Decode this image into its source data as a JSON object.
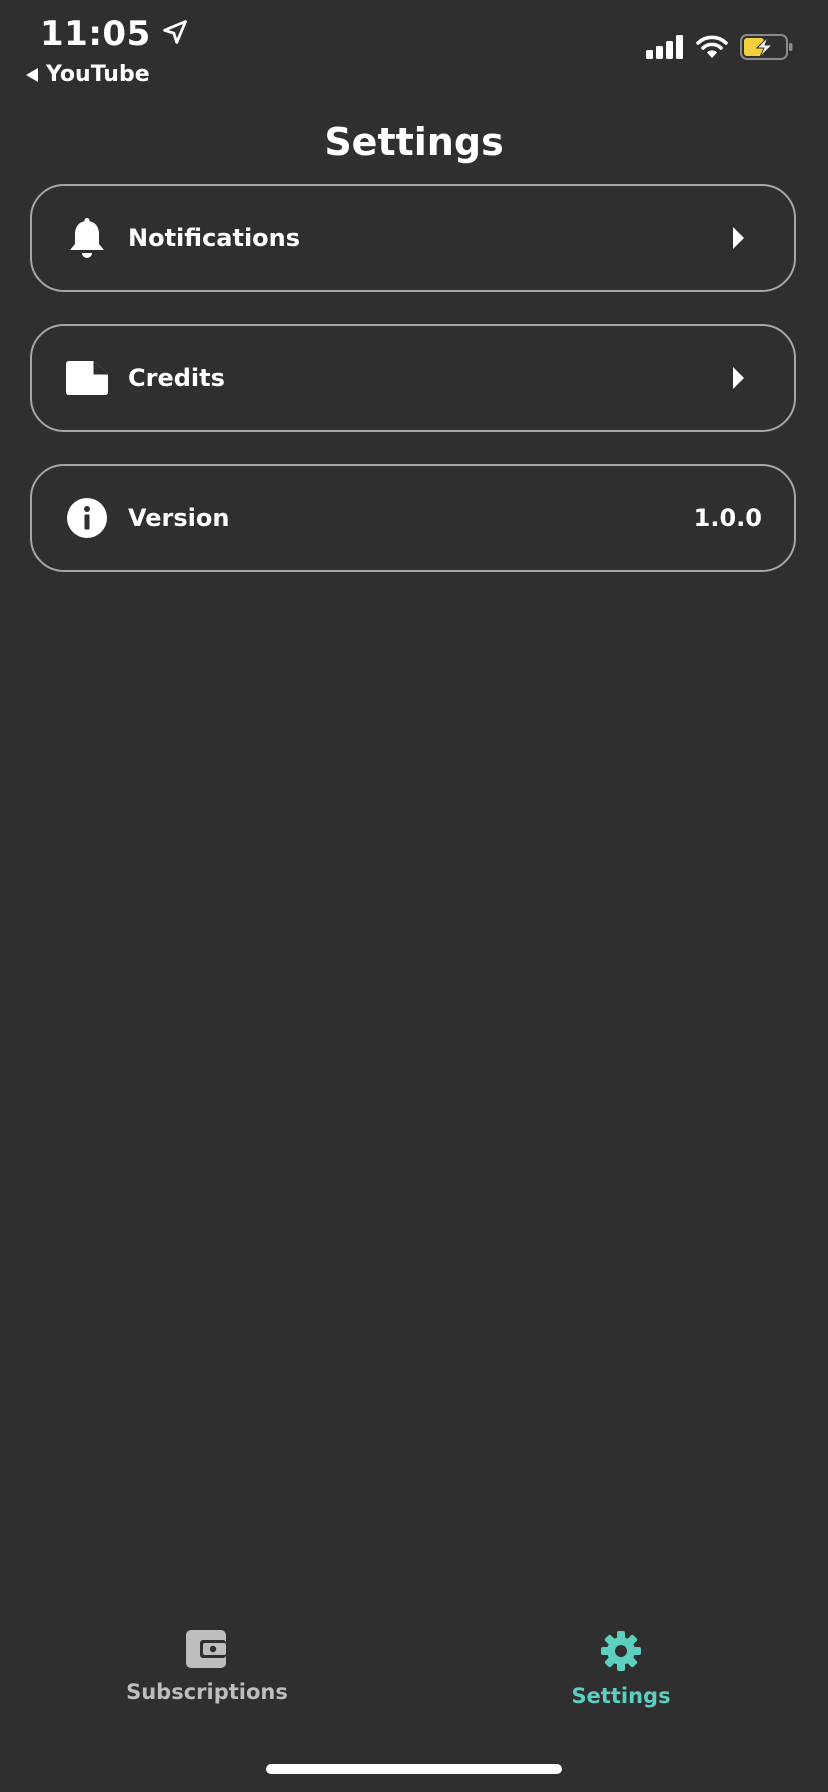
{
  "status_bar": {
    "time": "11:05",
    "back_app": "YouTube"
  },
  "header": {
    "title": "Settings"
  },
  "settings": {
    "items": [
      {
        "label": "Notifications",
        "icon": "bell-icon",
        "has_chevron": true
      },
      {
        "label": "Credits",
        "icon": "document-icon",
        "has_chevron": true
      },
      {
        "label": "Version",
        "icon": "info-icon",
        "value": "1.0.0"
      }
    ]
  },
  "tab_bar": {
    "tabs": [
      {
        "label": "Subscriptions",
        "icon": "wallet-icon",
        "active": false
      },
      {
        "label": "Settings",
        "icon": "gear-icon",
        "active": true
      }
    ]
  },
  "colors": {
    "background": "#2f2f2f",
    "row_border": "#a6a6a6",
    "accent": "#5ccfc0",
    "inactive_tab": "#bdbdbd",
    "battery_fill": "#f4d03f"
  }
}
